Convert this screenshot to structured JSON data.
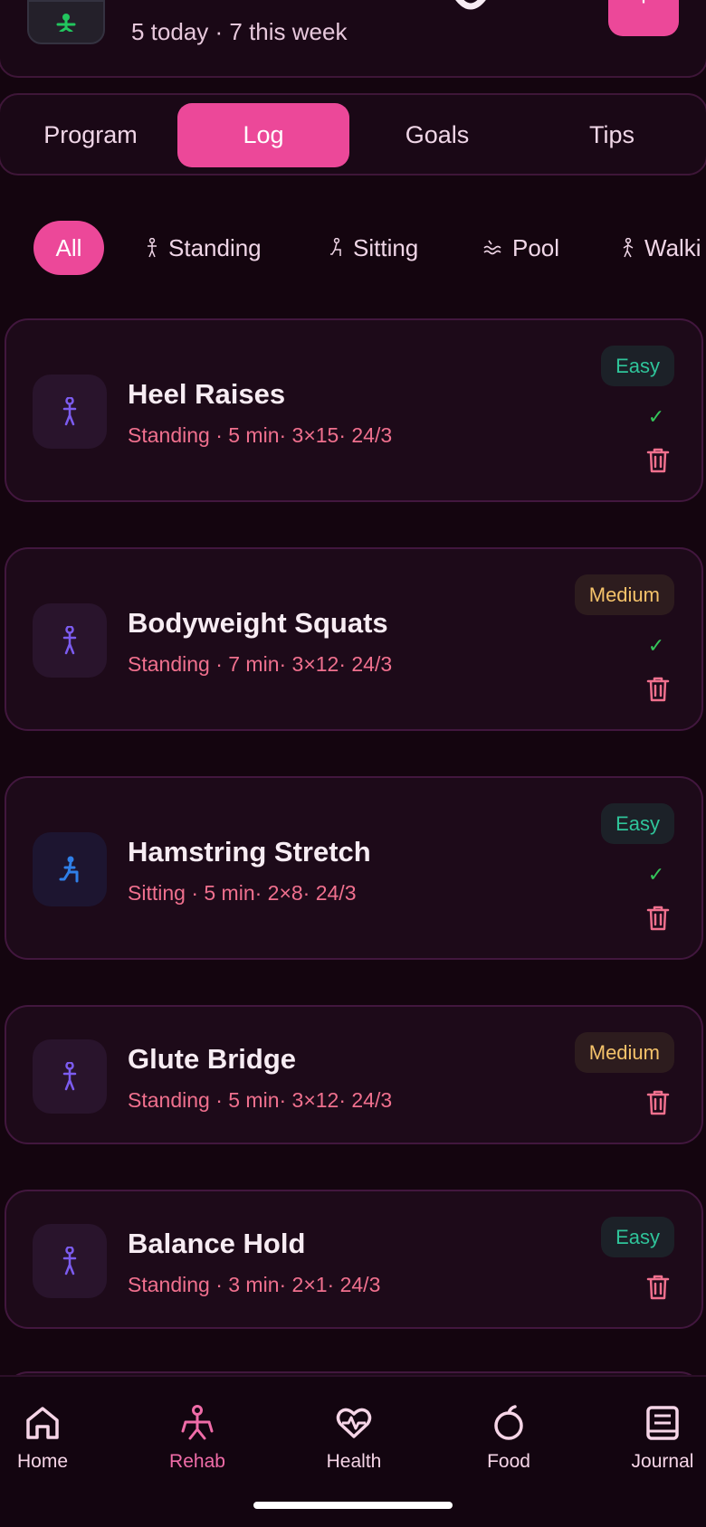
{
  "header": {
    "subtitle": "5 today · 7 this week",
    "add_label": "+"
  },
  "tabs": [
    {
      "label": "Program"
    },
    {
      "label": "Log"
    },
    {
      "label": "Goals"
    },
    {
      "label": "Tips"
    }
  ],
  "active_tab": "Log",
  "filters": [
    {
      "label": "All",
      "icon": "none"
    },
    {
      "label": "Standing",
      "icon": "standing-person-icon"
    },
    {
      "label": "Sitting",
      "icon": "sitting-person-icon"
    },
    {
      "label": "Pool",
      "icon": "water-waves-icon"
    },
    {
      "label": "Walki",
      "icon": "walking-person-icon"
    }
  ],
  "exercises": [
    {
      "title": "Heel Raises",
      "meta": "Standing · 5 min· 3×15· 24/3",
      "difficulty": "Easy",
      "done": true,
      "icon": "standing-person-icon"
    },
    {
      "title": "Bodyweight Squats",
      "meta": "Standing · 7 min· 3×12· 24/3",
      "difficulty": "Medium",
      "done": true,
      "icon": "standing-person-icon"
    },
    {
      "title": "Hamstring Stretch",
      "meta": "Sitting · 5 min· 2×8· 24/3",
      "difficulty": "Easy",
      "done": true,
      "icon": "sitting-person-icon"
    },
    {
      "title": "Glute Bridge",
      "meta": "Standing · 5 min· 3×12· 24/3",
      "difficulty": "Medium",
      "done": false,
      "icon": "standing-person-icon"
    },
    {
      "title": "Balance Hold",
      "meta": "Standing · 3 min· 2×1· 24/3",
      "difficulty": "Easy",
      "done": false,
      "icon": "standing-person-icon"
    }
  ],
  "bottom_nav": [
    {
      "label": "Home",
      "icon": "home-icon"
    },
    {
      "label": "Rehab",
      "icon": "rehab-figure-icon"
    },
    {
      "label": "Health",
      "icon": "heart-pulse-icon"
    },
    {
      "label": "Food",
      "icon": "apple-icon"
    },
    {
      "label": "Journal",
      "icon": "journal-icon"
    }
  ],
  "active_nav": "Rehab",
  "colors": {
    "accent": "#ec4899",
    "easy": "#2fc49a",
    "medium": "#f4c26a",
    "meta": "#f0708e",
    "check": "#34c55a",
    "trash": "#f0708e"
  }
}
